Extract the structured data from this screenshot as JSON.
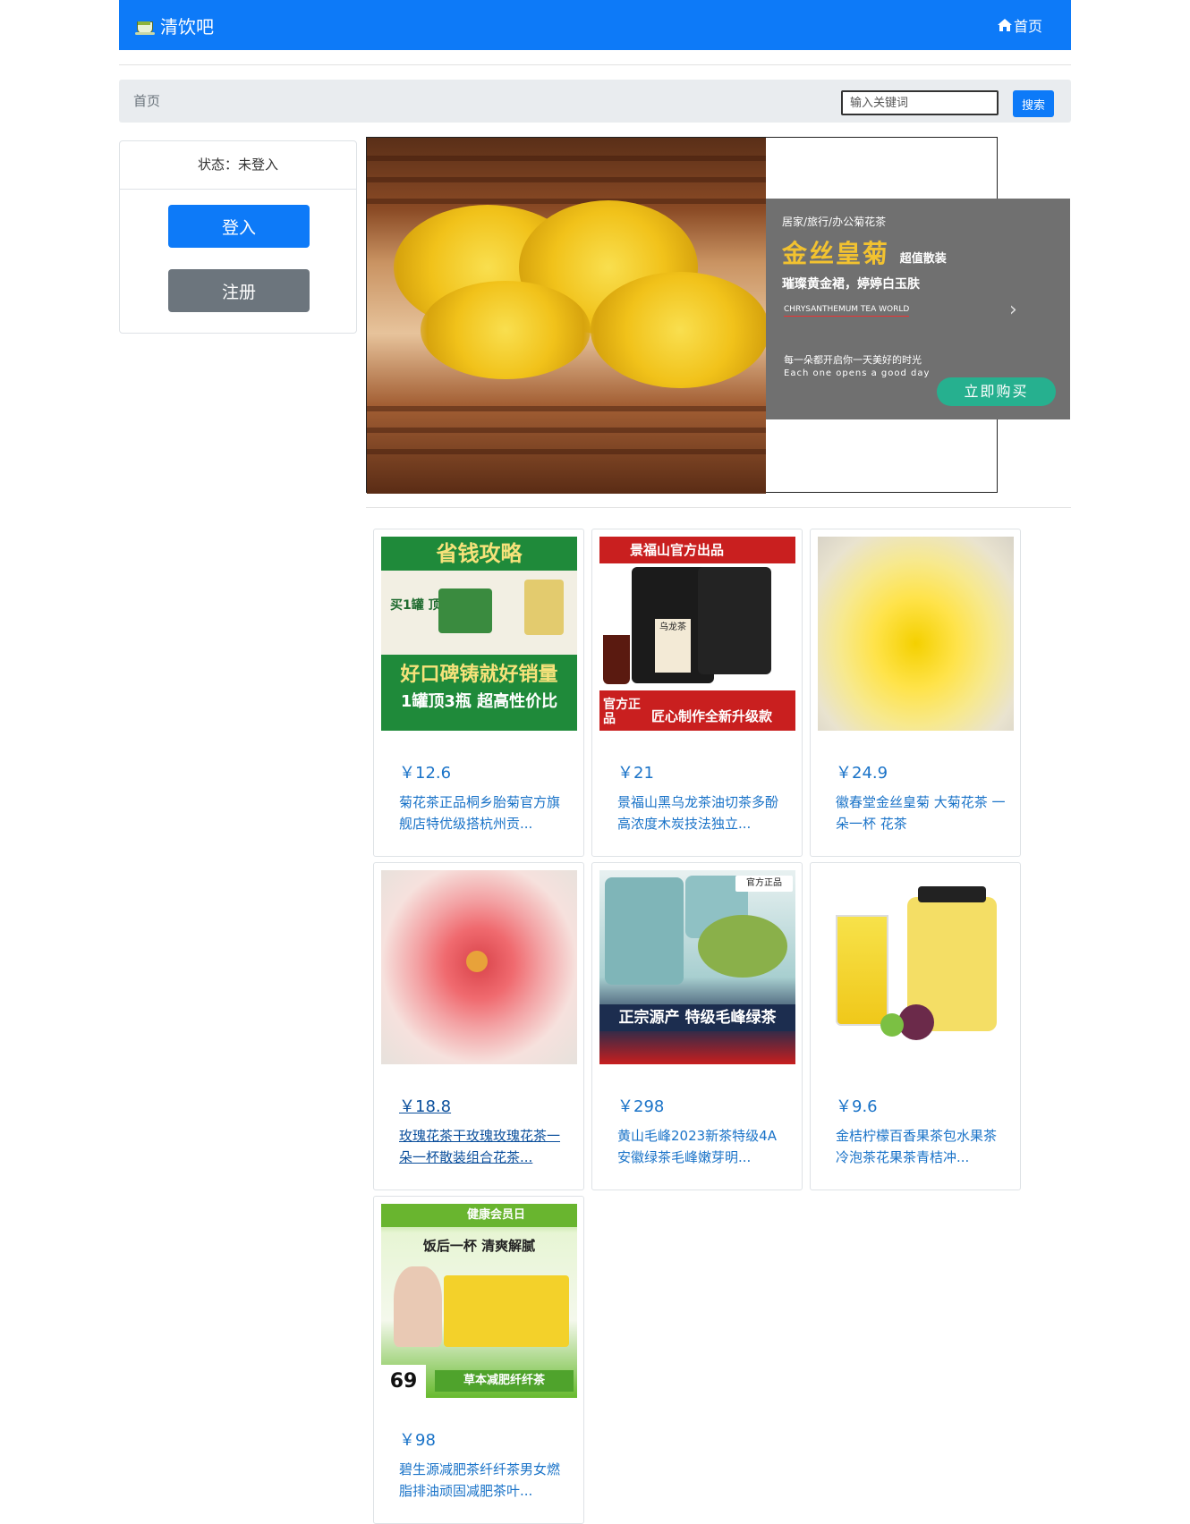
{
  "nav": {
    "brand": "清饮吧",
    "home": "首页"
  },
  "breadcrumb": {
    "current": "首页"
  },
  "search": {
    "placeholder": "输入关键词",
    "button": "搜索"
  },
  "sidebar": {
    "status": "状态：未登入",
    "login": "登入",
    "register": "注册"
  },
  "banner": {
    "line1": "居家/旅行/办公菊花茶",
    "title": "金丝皇菊",
    "title_tag": "超值散装",
    "slogan": "璀璨黄金裙，婷婷白玉肤",
    "en": "CHRYSANTHEMUM TEA WORLD",
    "line5": "每一朵都开启你一天美好的时光",
    "line6": "Each one opens a good day",
    "buy": "立即购买"
  },
  "products": [
    {
      "price": "￥12.6",
      "title": "菊花茶正品桐乡胎菊官方旗舰店特优级搭杭州贡...",
      "image_text_top": "省钱攻略",
      "image_text_mid": "买1罐 顶3瓶 VS",
      "image_text_bottom": "好口碑铸就好销量",
      "image_text_bottom2": "1罐顶3瓶 超高性价比"
    },
    {
      "price": "￥21",
      "title": "景福山黑乌龙茶油切茶多酚高浓度木炭技法独立...",
      "image_text_top": "景福山官方出品",
      "image_text_mid": "乌龙茶",
      "image_text_bottom": "官方正品",
      "image_text_bottom2": "匠心制作全新升级款"
    },
    {
      "price": "￥24.9",
      "title": "徽春堂金丝皇菊 大菊花茶 一朵一杯 花茶"
    },
    {
      "price": "￥18.8",
      "title": "玫瑰花茶干玫瑰玫瑰花茶一朵一杯散装组合花茶..."
    },
    {
      "price": "￥298",
      "title": "黄山毛峰2023新茶特级4A安徽绿茶毛峰嫩芽明...",
      "image_text_top": "官方正品",
      "image_text_bottom": "正宗源产 特级毛峰绿茶"
    },
    {
      "price": "￥9.6",
      "title": "金桔柠檬百香果茶包水果茶冷泡茶花果茶青桔冲..."
    },
    {
      "price": "￥98",
      "title": "碧生源减肥茶纤纤茶男女燃脂排油顽固减肥茶叶...",
      "image_text_top": "健康会员日",
      "image_text_mid": "饭后一杯 清爽解腻",
      "image_text_bottom": "草本减肥纤纤茶",
      "image_text_price": "69"
    }
  ]
}
